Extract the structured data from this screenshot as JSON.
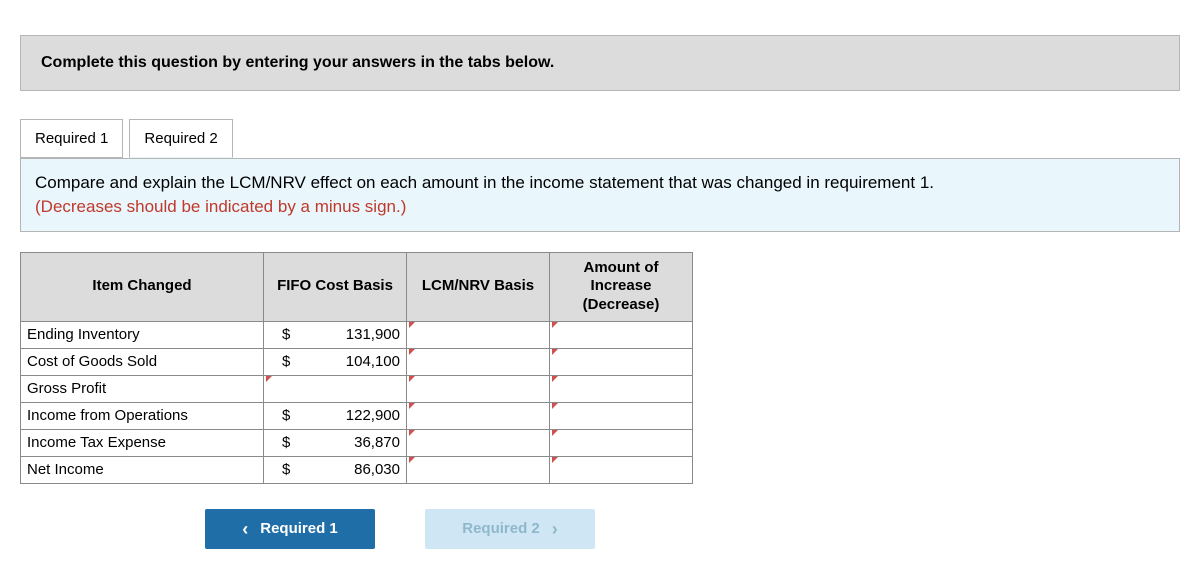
{
  "instruction": "Complete this question by entering your answers in the tabs below.",
  "tabs": [
    "Required 1",
    "Required 2"
  ],
  "active_tab": 1,
  "prompt_main": "Compare and explain the LCM/NRV effect on each amount in the income statement that was changed in requirement 1.",
  "prompt_note": "(Decreases should be indicated by a minus sign.)",
  "headers": {
    "item": "Item Changed",
    "fifo": "FIFO Cost Basis",
    "lcm": "LCM/NRV Basis",
    "amt": "Amount of Increase (Decrease)"
  },
  "rows": [
    {
      "label": "Ending Inventory",
      "fifo_cur": "$",
      "fifo_val": "131,900",
      "lcm_tick": true,
      "amt_tick": true
    },
    {
      "label": "Cost of Goods Sold",
      "fifo_cur": "$",
      "fifo_val": "104,100",
      "lcm_tick": true,
      "amt_tick": true
    },
    {
      "label": "Gross Profit",
      "fifo_cur": "",
      "fifo_val": "",
      "fifo_tick": true,
      "lcm_tick": true,
      "amt_tick": true
    },
    {
      "label": "Income from Operations",
      "fifo_cur": "$",
      "fifo_val": "122,900",
      "lcm_tick": true,
      "amt_tick": true
    },
    {
      "label": "Income Tax Expense",
      "fifo_cur": "$",
      "fifo_val": "36,870",
      "lcm_tick": true,
      "amt_tick": true
    },
    {
      "label": "Net Income",
      "fifo_cur": "$",
      "fifo_val": "86,030",
      "lcm_tick": true,
      "amt_tick": true
    }
  ],
  "nav": {
    "prev": "Required 1",
    "next": "Required 2"
  }
}
